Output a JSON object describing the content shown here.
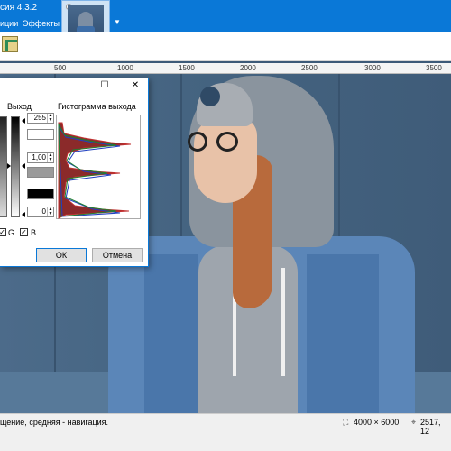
{
  "app": {
    "title": "сия 4.3.2"
  },
  "menu": {
    "items": [
      {
        "label": "иции"
      },
      {
        "label": "Эффекты"
      }
    ]
  },
  "ruler": {
    "labels": [
      "500",
      "1000",
      "1500",
      "2000",
      "2500",
      "3000",
      "3500"
    ]
  },
  "dialog": {
    "output_label": "Выход",
    "histogram_label": "Гистограмма выхода",
    "spin_top": "255",
    "spin_mid": "1,00",
    "spin_bottom": "0",
    "check_g": "G",
    "check_b": "B",
    "ok_label": "ОК",
    "cancel_label": "Отмена",
    "restore_glyph": "☐",
    "close_glyph": "✕"
  },
  "status": {
    "hint": "щение, средняя - навигация.",
    "image_size": "4000 × 6000",
    "coords": "2517, 12"
  },
  "colors": {
    "accent": "#0a78d7"
  }
}
